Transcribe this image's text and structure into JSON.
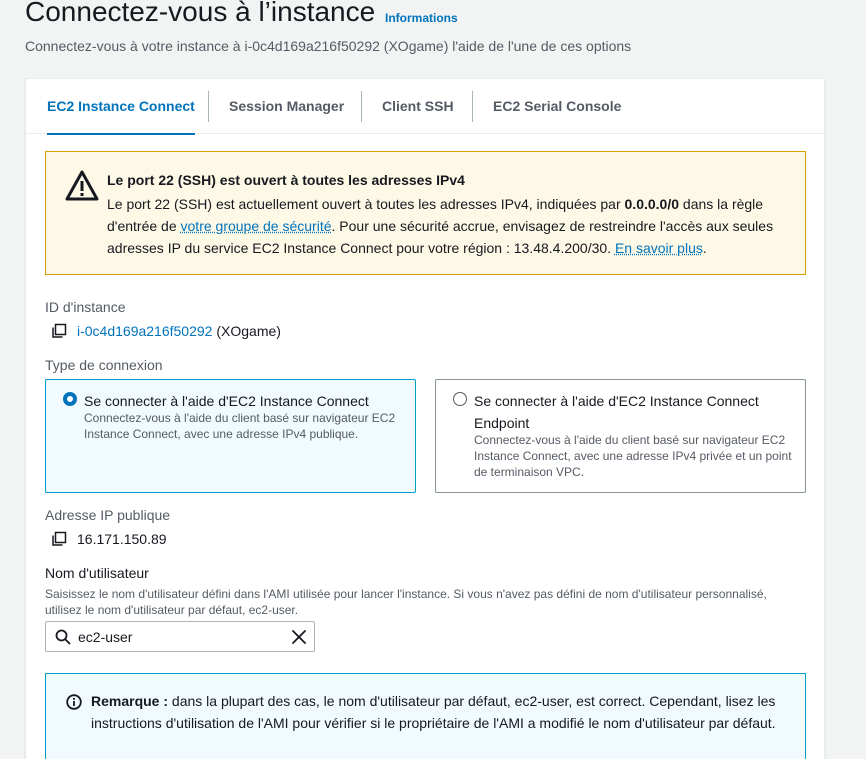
{
  "header": {
    "title": "Connectez-vous à l’instance",
    "info_link": "Informations",
    "subtitle": "Connectez-vous à votre instance à i-0c4d169a216f50292 (XOgame) l'aide de l'une de ces options"
  },
  "tabs": [
    {
      "label": "EC2 Instance Connect",
      "active": true
    },
    {
      "label": "Session Manager",
      "active": false
    },
    {
      "label": "Client SSH",
      "active": false
    },
    {
      "label": "EC2 Serial Console",
      "active": false
    }
  ],
  "warning": {
    "title": "Le port 22 (SSH) est ouvert à toutes les adresses IPv4",
    "text_1": "Le port 22 (SSH) est actuellement ouvert à toutes les adresses IPv4, indiquées par ",
    "cidr": "0.0.0.0/0",
    "text_2": " dans la règle d'entrée de ",
    "sg_link": "votre groupe de sécurité",
    "text_3": ". Pour une sécurité accrue, envisagez de restreindre l'accès aux seules adresses IP du service EC2 Instance Connect pour votre région : 13.48.4.200/30. ",
    "learn_more": "En savoir plus",
    "text_4": ".",
    "color": "#d9a000"
  },
  "instance": {
    "label": "ID d'instance",
    "id": "i-0c4d169a216f50292",
    "name": "(XOgame)"
  },
  "connection_type": {
    "label": "Type de connexion",
    "options": [
      {
        "title": "Se connecter à l'aide d'EC2 Instance Connect",
        "description": "Connectez-vous à l'aide du client basé sur navigateur EC2 Instance Connect, avec une adresse IPv4 publique.",
        "selected": true
      },
      {
        "title": "Se connecter à l'aide d'EC2 Instance Connect Endpoint",
        "description": "Connectez-vous à l'aide du client basé sur navigateur EC2 Instance Connect, avec une adresse IPv4 privée et un point de terminaison VPC.",
        "selected": false
      }
    ]
  },
  "public_ip": {
    "label": "Adresse IP publique",
    "value": "16.171.150.89"
  },
  "username": {
    "label": "Nom d'utilisateur",
    "help": "Saisissez le nom d'utilisateur défini dans l'AMI utilisée pour lancer l'instance. Si vous n'avez pas défini de nom d'utilisateur personnalisé, utilisez le nom d'utilisateur par défaut, ec2-user.",
    "value": "ec2-user"
  },
  "note": {
    "bold": "Remarque :",
    "text": " dans la plupart des cas, le nom d'utilisateur par défaut, ec2-user, est correct. Cependant, lisez les instructions d'utilisation de l'AMI pour vérifier si le propriétaire de l'AMI a modifié le nom d'utilisateur par défaut."
  },
  "icons": {
    "warning": "warning-icon",
    "copy": "copy-icon",
    "search": "search-icon",
    "clear": "close-icon",
    "info": "info-icon"
  },
  "colors": {
    "accent": "#0073bb",
    "info_border": "#00a1c9"
  }
}
